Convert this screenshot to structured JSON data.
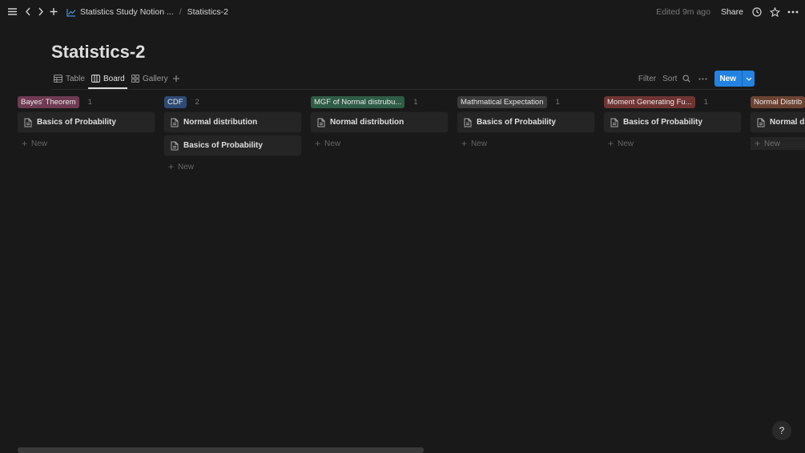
{
  "topbar": {
    "breadcrumb_parent": "Statistics Study Notion ...",
    "breadcrumb_sep": "/",
    "breadcrumb_current": "Statistics-2",
    "edited": "Edited 9m ago",
    "share": "Share"
  },
  "page": {
    "title": "Statistics-2"
  },
  "views": {
    "tabs": [
      {
        "label": "Table",
        "icon": "table-icon"
      },
      {
        "label": "Board",
        "icon": "board-icon"
      },
      {
        "label": "Gallery",
        "icon": "gallery-icon"
      }
    ],
    "active": "Board",
    "filter": "Filter",
    "sort": "Sort",
    "new": "New"
  },
  "columns": [
    {
      "tag": "Bayes' Theorem",
      "color": "#6e3b53",
      "count": "1",
      "cards": [
        "Basics of Probability"
      ],
      "add": "New"
    },
    {
      "tag": "CDF",
      "color": "#2e4a73",
      "count": "2",
      "cards": [
        "Normal distribution",
        "Basics of Probability"
      ],
      "add": "New"
    },
    {
      "tag": "MGF of Normal distrubu...",
      "color": "#2f5c45",
      "count": "1",
      "cards": [
        "Normal distribution"
      ],
      "add": "New"
    },
    {
      "tag": "Mathmatical Expectation",
      "color": "#3b3b3b",
      "count": "1",
      "cards": [
        "Basics of Probability"
      ],
      "add": "New"
    },
    {
      "tag": "Moment Generating Fu...",
      "color": "#6e3433",
      "count": "1",
      "cards": [
        "Basics of Probability"
      ],
      "add": "New"
    },
    {
      "tag": "Normal Distrib",
      "color": "#6b4333",
      "count": "",
      "cards": [
        "Normal dis"
      ],
      "add": "New"
    }
  ],
  "help": "?",
  "colors": {
    "accent": "#2383e2",
    "background": "#191919",
    "card": "#252525"
  }
}
